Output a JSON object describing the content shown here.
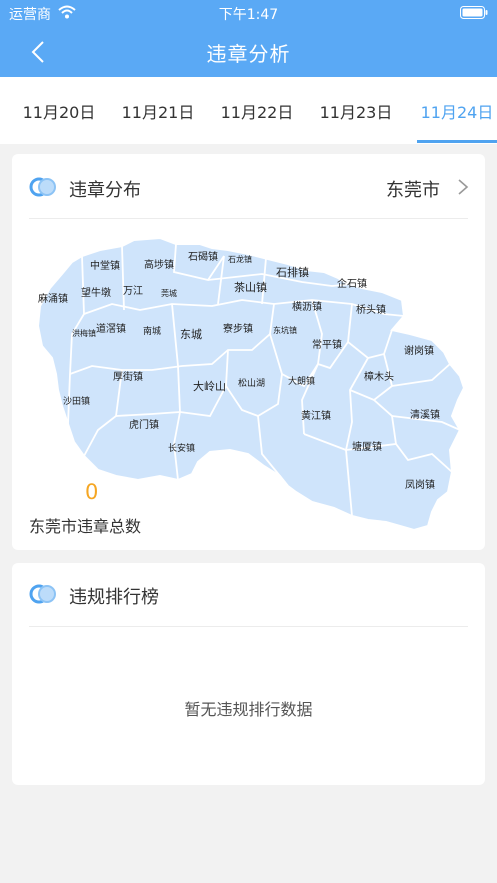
{
  "status_bar": {
    "carrier": "运营商",
    "time": "下午1:47"
  },
  "header": {
    "title": "违章分析"
  },
  "date_tabs": [
    {
      "label": "11月20日",
      "active": false
    },
    {
      "label": "11月21日",
      "active": false
    },
    {
      "label": "11月22日",
      "active": false
    },
    {
      "label": "11月23日",
      "active": false
    },
    {
      "label": "11月24日",
      "active": true
    }
  ],
  "distribution": {
    "title": "违章分布",
    "city": "东莞市",
    "total_value": "0",
    "total_label": "东莞市违章总数",
    "map_fill": "#cfe4fb",
    "towns": [
      "中堂镇",
      "高埗镇",
      "石碣镇",
      "石龙镇",
      "麻涌镇",
      "望牛墩",
      "万江",
      "莞城",
      "石排镇",
      "茶山镇",
      "企石镇",
      "横沥镇",
      "桥头镇",
      "洪梅镇",
      "道滘镇",
      "南城",
      "东城",
      "寮步镇",
      "东坑镇",
      "常平镇",
      "谢岗镇",
      "厚街镇",
      "大岭山",
      "松山湖",
      "大朗镇",
      "樟木头",
      "沙田镇",
      "虎门镇",
      "黄江镇",
      "清溪镇",
      "长安镇",
      "塘厦镇",
      "凤岗镇"
    ]
  },
  "ranking": {
    "title": "违规排行榜",
    "empty_text": "暂无违规排行数据"
  },
  "colors": {
    "brand": "#5aa9f5",
    "accent": "#4fa3f0",
    "highlight": "#f5a623"
  }
}
